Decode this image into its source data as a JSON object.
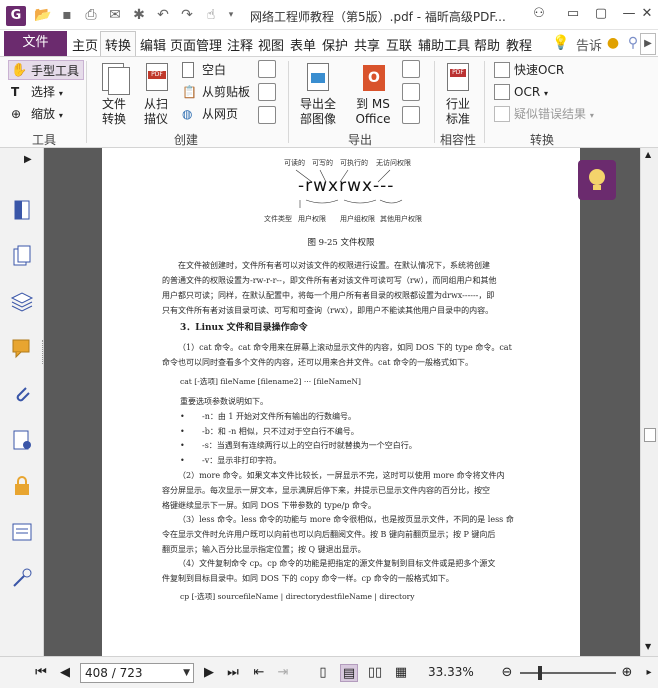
{
  "window": {
    "title": "网络工程师教程（第5版）.pdf - 福昕高级PDF...",
    "app_logo": "G"
  },
  "tabs": {
    "file": "文件",
    "items": [
      "主页",
      "转换",
      "编辑",
      "页面管理",
      "注释",
      "视图",
      "表单",
      "保护",
      "共享",
      "互联",
      "辅助工具",
      "帮助",
      "教程"
    ],
    "active": "转换",
    "tell_me": "告诉"
  },
  "ribbon": {
    "tools": {
      "hand": "手型工具",
      "select": "选择",
      "zoom": "缩放",
      "group": "工具"
    },
    "create": {
      "file_convert": [
        "文件",
        "转换"
      ],
      "from_scan": [
        "从扫",
        "描仪"
      ],
      "blank": "空白",
      "from_clipboard": "从剪贴板",
      "from_web": "从网页",
      "group": "创建"
    },
    "export": {
      "export_all_images": [
        "导出全",
        "部图像"
      ],
      "to_ms_office": [
        "到 MS",
        "Office"
      ],
      "group": "导出"
    },
    "compliance": {
      "industry_standard": [
        "行业",
        "标准"
      ],
      "group": "相容性"
    },
    "convert": {
      "quick_ocr": "快速OCR",
      "ocr": "OCR",
      "suspect_results": "疑似错误结果",
      "group": "转换"
    }
  },
  "document": {
    "figure_top_labels": [
      "可读的",
      "可写的",
      "可执行的",
      "无访问权限"
    ],
    "rwx": "-rwxrwx---",
    "figure_bottom_labels": [
      "文件类型",
      "用户权限",
      "用户组权限",
      "其他用户权限"
    ],
    "figure_caption": "图 9-25   文件权限",
    "para1": [
      "在文件被创建时，文件所有者可以对该文件的权限进行设置。在默认情况下，系统将创建",
      "的普通文件的权限设置为-rw-r-r--，即文件所有者对该文件可读可写（rw），而同组用户和其他",
      "用户都只可读；同样，在默认配置中，将每一个用户所有者目录的权限都设置为drwx------，即",
      "只有文件所有者对该目录可读、可写和可查询（rwx），即用户不能读其他用户目录中的内容。"
    ],
    "heading": "3．Linux 文件和目录操作命令",
    "para2": [
      "（1）cat 命令。cat 命令用来在屏幕上滚动显示文件的内容，如同 DOS 下的 type 命令。cat",
      "命令也可以同时查看多个文件的内容，还可以用来合并文件。cat 命令的一般格式如下。"
    ],
    "code1": "cat [-选项] fileName [filename2] ··· [fileNameN]",
    "options_intro": "重要选项参数说明如下。",
    "bullets": [
      "-n：由 1 开始对文件所有输出的行数编号。",
      "-b：和 -n 相似，只不过对于空白行不编号。",
      "-s：当遇到有连续两行以上的空白行时就替换为一个空白行。",
      "-v：显示非打印字符。"
    ],
    "para3": [
      "（2）more 命令。如果文本文件比较长，一屏显示不完，这时可以使用 more 命令将文件内",
      "容分屏显示。每次显示一屏文本，显示满屏后停下来，并提示已显示文件内容的百分比，按空",
      "格键继续显示下一屏。如同 DOS 下带参数的 type/p 命令。"
    ],
    "para4": [
      "（3）less 命令。less 命令的功能与 more 命令很相似，也是按页显示文件，不同的是 less 命",
      "令在显示文件时允许用户既可以向前也可以向后翻阅文件。按 B 键向前翻页显示；按 P 键向后",
      "翻页显示；输入百分比显示指定位置；按 Q 键退出显示。"
    ],
    "para5": [
      "（4）文件复制命令 cp。cp 命令的功能是把指定的源文件复制到目标文件或是把多个源文",
      "件复制到目标目录中。如同 DOS 下的 copy 命令一样。cp 命令的一般格式如下。"
    ],
    "code2": "cp [-选项] sourcefileName | directorydestfileName | directory"
  },
  "statusbar": {
    "page_indicator": "408 / 723",
    "zoom": "33.33%",
    "zoom_fraction": 0.2
  },
  "colors": {
    "brand": "#6b2b6e",
    "ribbon_bg": "#fafafa",
    "doc_bg": "#5a5a5a"
  }
}
